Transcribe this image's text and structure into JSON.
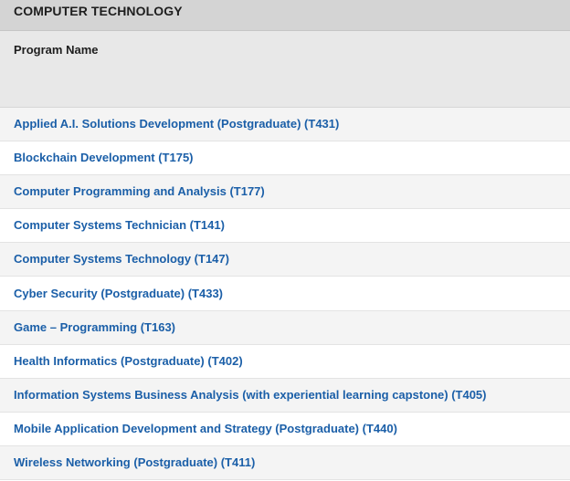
{
  "section": {
    "title": "COMPUTER TECHNOLOGY"
  },
  "table": {
    "column_header": "Program Name",
    "rows": [
      "Applied A.I. Solutions Development (Postgraduate) (T431)",
      "Blockchain Development (T175)",
      "Computer Programming and Analysis (T177)",
      "Computer Systems Technician (T141)",
      "Computer Systems Technology (T147)",
      "Cyber Security (Postgraduate) (T433)",
      "Game – Programming (T163)",
      "Health Informatics (Postgraduate) (T402)",
      "Information Systems Business Analysis (with experiential learning capstone) (T405)",
      "Mobile Application Development and Strategy (Postgraduate) (T440)",
      "Wireless Networking (Postgraduate) (T411)"
    ]
  },
  "colors": {
    "link": "#1b5fa8",
    "header_bg": "#d4d4d4",
    "column_header_bg": "#e8e8e8",
    "row_alt_bg": "#f4f4f4"
  }
}
